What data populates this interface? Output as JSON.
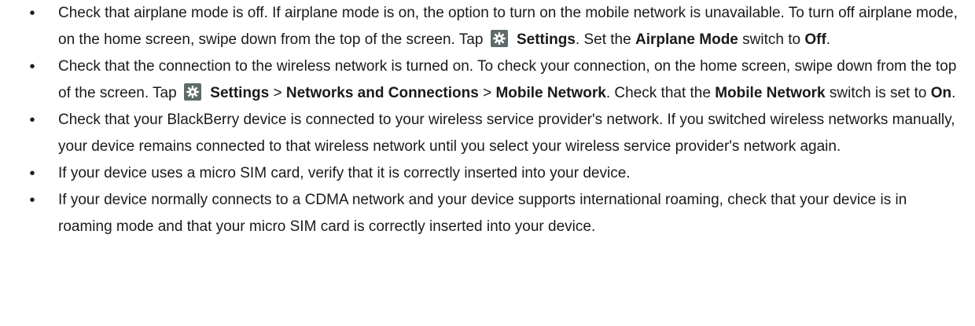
{
  "bullets": [
    {
      "p1": "Check that airplane mode is off. If airplane mode is on, the option to turn on the mobile network is unavailable. To turn off airplane mode, on the home screen, swipe down from the top of the screen. Tap",
      "settings": "Settings",
      "p2": ". Set the ",
      "airplane_mode": "Airplane Mode",
      "p3": " switch to ",
      "off": "Off",
      "p4": "."
    },
    {
      "p1": "Check that the connection to the wireless network is turned on. To check your connection, on the home screen, swipe down from the top of the screen. Tap",
      "settings": "Settings",
      "sep1": " > ",
      "networks": "Networks and Connections",
      "sep2": " > ",
      "mobile_network": "Mobile Network",
      "p2": ". Check that the ",
      "mobile_network_2": "Mobile Network",
      "p3": " switch is set to ",
      "on": "On",
      "p4": "."
    },
    {
      "text": "Check that your BlackBerry device is connected to your wireless service provider's network. If you switched wireless networks manually, your device remains connected to that wireless network until you select your wireless service provider's network again."
    },
    {
      "text": "If your device uses a micro SIM card, verify that it is correctly inserted into your device."
    },
    {
      "text": "If your device normally connects to a CDMA network and your device supports international roaming, check that your device is in roaming mode and that your micro SIM card is correctly inserted into your device."
    }
  ],
  "bullet_glyph": "•",
  "icons": {
    "settings": "gear-icon"
  }
}
